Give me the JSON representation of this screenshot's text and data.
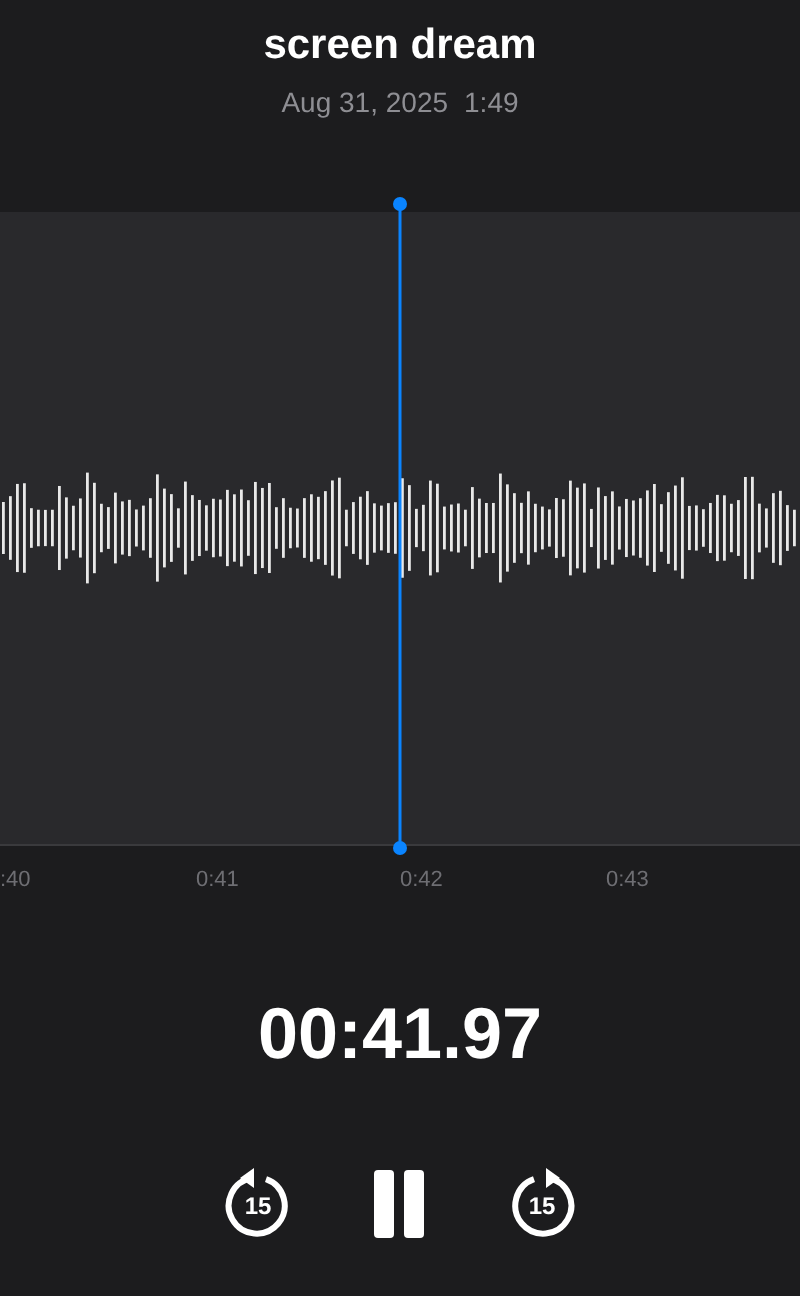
{
  "recording": {
    "title": "screen dream",
    "date": "Aug 31, 2025",
    "duration": "1:49"
  },
  "timeline": {
    "ticks": [
      ":40",
      "0:41",
      "0:42",
      "0:43"
    ]
  },
  "playback": {
    "time": "00:41.97",
    "skip_back": "15",
    "skip_forward": "15",
    "playing": true
  }
}
